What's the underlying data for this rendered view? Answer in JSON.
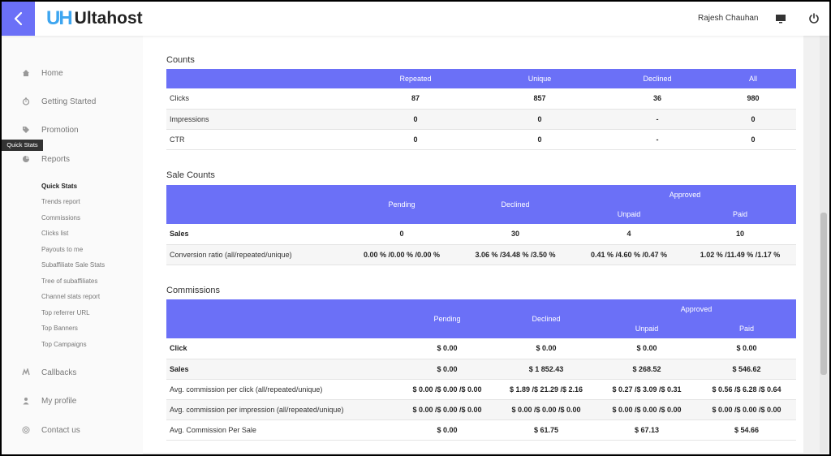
{
  "app": {
    "logo_mark": "UH",
    "logo_text": "Ultahost",
    "user_name": "Rajesh Chauhan",
    "accent_color": "#6b70f7"
  },
  "sidebar": {
    "tooltip": "Quick Stats",
    "items": [
      {
        "label": "Home",
        "icon": "home-icon"
      },
      {
        "label": "Getting Started",
        "icon": "timer-icon"
      },
      {
        "label": "Promotion",
        "icon": "tag-icon"
      },
      {
        "label": "Reports",
        "icon": "pie-chart-icon"
      },
      {
        "label": "Callbacks",
        "icon": "callbacks-icon"
      },
      {
        "label": "My profile",
        "icon": "user-icon"
      },
      {
        "label": "Contact us",
        "icon": "at-icon"
      }
    ],
    "reports_sub": [
      "Quick Stats",
      "Trends report",
      "Commissions",
      "Clicks list",
      "Payouts to me",
      "Subaffiliate Sale Stats",
      "Tree of subaffiliates",
      "Channel stats report",
      "Top referrer URL",
      "Top Banners",
      "Top Campaigns"
    ]
  },
  "counts": {
    "title": "Counts",
    "headers": [
      "Repeated",
      "Unique",
      "Declined",
      "All"
    ],
    "rows": [
      {
        "label": "Clicks",
        "values": [
          "87",
          "857",
          "36",
          "980"
        ]
      },
      {
        "label": "Impressions",
        "values": [
          "0",
          "0",
          "-",
          "0"
        ]
      },
      {
        "label": "CTR",
        "values": [
          "0",
          "0",
          "-",
          "0"
        ]
      }
    ]
  },
  "sale_counts": {
    "title": "Sale Counts",
    "headers": {
      "pending": "Pending",
      "declined": "Declined",
      "approved": "Approved",
      "unpaid": "Unpaid",
      "paid": "Paid"
    },
    "rows": [
      {
        "label": "Sales",
        "values": [
          "0",
          "30",
          "4",
          "10"
        ]
      },
      {
        "label": "Conversion ratio (all/repeated/unique)",
        "values": [
          "0.00 % /0.00 % /0.00 %",
          "3.06 % /34.48 % /3.50 %",
          "0.41 % /4.60 % /0.47 %",
          "1.02 % /11.49 % /1.17 %"
        ]
      }
    ]
  },
  "commissions": {
    "title": "Commissions",
    "headers": {
      "pending": "Pending",
      "declined": "Declined",
      "approved": "Approved",
      "unpaid": "Unpaid",
      "paid": "Paid"
    },
    "rows": [
      {
        "label": "Click",
        "values": [
          "$ 0.00",
          "$ 0.00",
          "$ 0.00",
          "$ 0.00"
        ]
      },
      {
        "label": "Sales",
        "values": [
          "$ 0.00",
          "$ 1 852.43",
          "$ 268.52",
          "$ 546.62"
        ]
      },
      {
        "label": "Avg. commission per click (all/repeated/unique)",
        "values": [
          "$ 0.00 /$ 0.00 /$ 0.00",
          "$ 1.89 /$ 21.29 /$ 2.16",
          "$ 0.27 /$ 3.09 /$ 0.31",
          "$ 0.56 /$ 6.28 /$ 0.64"
        ]
      },
      {
        "label": "Avg. commission per impression (all/repeated/unique)",
        "values": [
          "$ 0.00 /$ 0.00 /$ 0.00",
          "$ 0.00 /$ 0.00 /$ 0.00",
          "$ 0.00 /$ 0.00 /$ 0.00",
          "$ 0.00 /$ 0.00 /$ 0.00"
        ]
      },
      {
        "label": "Avg. Commission Per Sale",
        "values": [
          "$ 0.00",
          "$ 61.75",
          "$ 67.13",
          "$ 54.66"
        ]
      }
    ]
  }
}
